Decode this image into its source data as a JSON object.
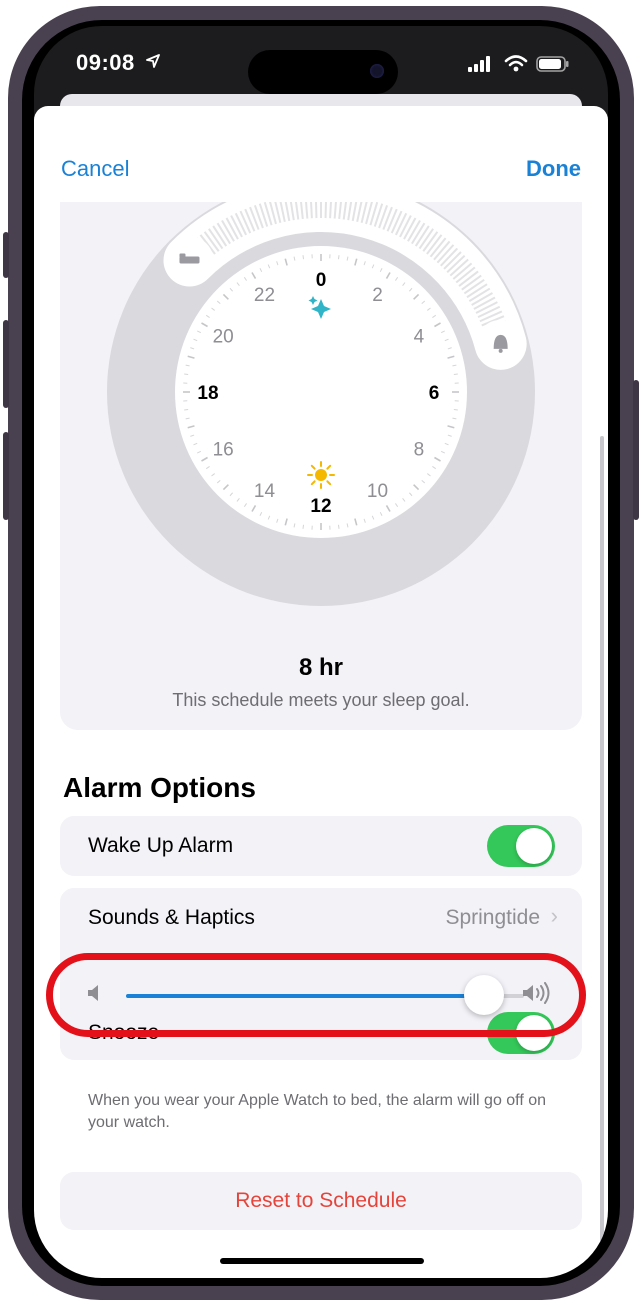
{
  "status_bar": {
    "time": "09:08"
  },
  "nav": {
    "cancel_label": "Cancel",
    "done_label": "Done"
  },
  "clock": {
    "hour_labels": [
      {
        "label": "0",
        "hour": 0,
        "bold": true
      },
      {
        "label": "2",
        "hour": 2,
        "bold": false
      },
      {
        "label": "4",
        "hour": 4,
        "bold": false
      },
      {
        "label": "6",
        "hour": 6,
        "bold": true
      },
      {
        "label": "8",
        "hour": 8,
        "bold": false
      },
      {
        "label": "10",
        "hour": 10,
        "bold": false
      },
      {
        "label": "12",
        "hour": 12,
        "bold": true
      },
      {
        "label": "14",
        "hour": 14,
        "bold": false
      },
      {
        "label": "16",
        "hour": 16,
        "bold": false
      },
      {
        "label": "18",
        "hour": 18,
        "bold": true
      },
      {
        "label": "20",
        "hour": 20,
        "bold": false
      },
      {
        "label": "22",
        "hour": 22,
        "bold": false
      }
    ],
    "bedtime_icon": "bed-icon",
    "wake_icon": "bell-icon",
    "midnight_icon": "sparkles-icon",
    "noon_icon": "sun-icon",
    "bedtime_hour": 21,
    "wake_hour": 5,
    "duration": "8 hr",
    "goal_message": "This schedule meets your sleep goal."
  },
  "alarm_options": {
    "title": "Alarm Options",
    "wake_up_alarm": {
      "label": "Wake Up Alarm",
      "on": true
    },
    "sounds_haptics": {
      "label": "Sounds & Haptics",
      "value": "Springtide"
    },
    "volume": {
      "level": 0.9,
      "low_icon": "speaker-low-icon",
      "high_icon": "speaker-high-icon"
    },
    "snooze": {
      "label": "Snooze",
      "on": true
    },
    "watch_note": "When you wear your Apple Watch to bed, the alarm will go off on your watch."
  },
  "reset_label": "Reset to Schedule",
  "colors": {
    "accent": "#1a82d6",
    "toggle_on": "#34c759",
    "destructive": "#e5443b",
    "highlight_ring": "#e2111a"
  }
}
